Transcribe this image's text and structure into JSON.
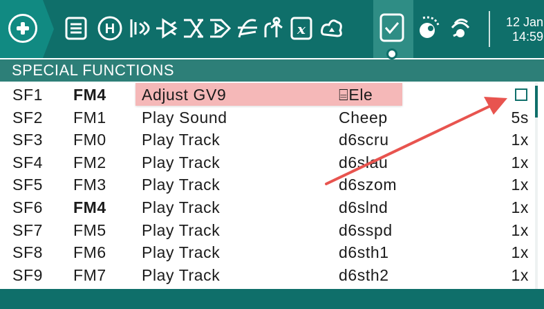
{
  "topbar": {
    "clock_date": "12 Jan",
    "clock_time": "14:59",
    "icons": [
      "model-setup-icon",
      "heli-setup-icon",
      "flight-modes-icon",
      "inputs-icon",
      "mixes-icon",
      "outputs-icon",
      "curves-icon",
      "global-variables-icon",
      "logical-switches-icon",
      "special-functions-icon",
      "telemetry-icon",
      "wireless-icon"
    ]
  },
  "section": {
    "title": "SPECIAL FUNCTIONS"
  },
  "rows": [
    {
      "sf": "SF1",
      "fm": "FM4",
      "fm_bold": true,
      "function": "Adjust GV9",
      "param": "⌸Ele",
      "value": "",
      "checkbox": true,
      "selected": true
    },
    {
      "sf": "SF2",
      "fm": "FM1",
      "fm_bold": false,
      "function": "Play Sound",
      "param": "Cheep",
      "value": "5s"
    },
    {
      "sf": "SF3",
      "fm": "FM0",
      "fm_bold": false,
      "function": "Play Track",
      "param": "d6scru",
      "value": "1x"
    },
    {
      "sf": "SF4",
      "fm": "FM2",
      "fm_bold": false,
      "function": "Play Track",
      "param": "d6slau",
      "value": "1x"
    },
    {
      "sf": "SF5",
      "fm": "FM3",
      "fm_bold": false,
      "function": "Play Track",
      "param": "d6szom",
      "value": "1x"
    },
    {
      "sf": "SF6",
      "fm": "FM4",
      "fm_bold": true,
      "function": "Play Track",
      "param": "d6slnd",
      "value": "1x"
    },
    {
      "sf": "SF7",
      "fm": "FM5",
      "fm_bold": false,
      "function": "Play Track",
      "param": "d6sspd",
      "value": "1x"
    },
    {
      "sf": "SF8",
      "fm": "FM6",
      "fm_bold": false,
      "function": "Play Track",
      "param": "d6sth1",
      "value": "1x"
    },
    {
      "sf": "SF9",
      "fm": "FM7",
      "fm_bold": false,
      "function": "Play Track",
      "param": "d6sth2",
      "value": "1x"
    }
  ],
  "colors": {
    "topbar": "#0f6f6a",
    "header": "#2d7f78",
    "selected_row": "#f5b8b8",
    "annotation_arrow": "#e8544f"
  }
}
